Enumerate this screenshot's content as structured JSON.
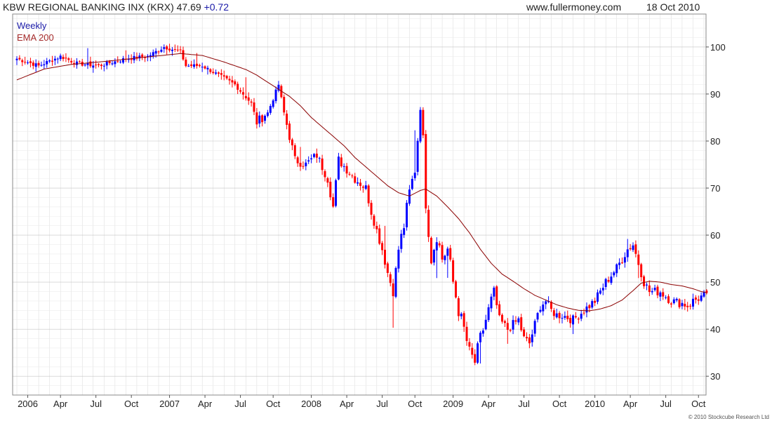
{
  "header": {
    "title": "KBW REGIONAL BANKING INX (KRX) 47.69",
    "change": "+0.72",
    "site": "www.fullermoney.com",
    "date": "18 Oct 2010"
  },
  "copyright": "© 2010 Stockcube Research Ltd",
  "colors": {
    "up": "#0000ff",
    "down": "#ff0000",
    "ema": "#8b0000",
    "grid": "#d8d8d8"
  },
  "chart_data": {
    "type": "candlestick",
    "ylim": [
      26,
      107
    ],
    "y_ticks": [
      30,
      40,
      50,
      60,
      70,
      80,
      90,
      100
    ],
    "x_ticks": [
      {
        "label": "2006",
        "i": 4
      },
      {
        "label": "Apr",
        "i": 16
      },
      {
        "label": "Jul",
        "i": 29
      },
      {
        "label": "Oct",
        "i": 42
      },
      {
        "label": "2007",
        "i": 56
      },
      {
        "label": "Apr",
        "i": 69
      },
      {
        "label": "Jul",
        "i": 82
      },
      {
        "label": "Oct",
        "i": 94
      },
      {
        "label": "2008",
        "i": 108
      },
      {
        "label": "Apr",
        "i": 121
      },
      {
        "label": "Jul",
        "i": 134
      },
      {
        "label": "Oct",
        "i": 146
      },
      {
        "label": "2009",
        "i": 160
      },
      {
        "label": "Apr",
        "i": 173
      },
      {
        "label": "Jul",
        "i": 186
      },
      {
        "label": "Oct",
        "i": 199
      },
      {
        "label": "2010",
        "i": 212
      },
      {
        "label": "Apr",
        "i": 225
      },
      {
        "label": "Jul",
        "i": 238
      },
      {
        "label": "Oct",
        "i": 250
      }
    ],
    "legend": [
      "Weekly",
      "EMA 200"
    ],
    "legend_position": "top-left",
    "anchors": [
      [
        0,
        97.5
      ],
      [
        8,
        96
      ],
      [
        16,
        98
      ],
      [
        22,
        96.5
      ],
      [
        30,
        96
      ],
      [
        40,
        97.5
      ],
      [
        48,
        98
      ],
      [
        54,
        100
      ],
      [
        60,
        99
      ],
      [
        62,
        96
      ],
      [
        68,
        96
      ],
      [
        74,
        94
      ],
      [
        80,
        92
      ],
      [
        86,
        88
      ],
      [
        88,
        84
      ],
      [
        92,
        86
      ],
      [
        96,
        92
      ],
      [
        98,
        86
      ],
      [
        102,
        76
      ],
      [
        106,
        75
      ],
      [
        110,
        77
      ],
      [
        114,
        72
      ],
      [
        116,
        66
      ],
      [
        118,
        76
      ],
      [
        124,
        72
      ],
      [
        128,
        70
      ],
      [
        130,
        65
      ],
      [
        134,
        57
      ],
      [
        136,
        52
      ],
      [
        138,
        48
      ],
      [
        140,
        57
      ],
      [
        142,
        62
      ],
      [
        144,
        69
      ],
      [
        146,
        74
      ],
      [
        148,
        87
      ],
      [
        149,
        80
      ],
      [
        150,
        67
      ],
      [
        152,
        55
      ],
      [
        154,
        60
      ],
      [
        156,
        55
      ],
      [
        158,
        57
      ],
      [
        160,
        50
      ],
      [
        162,
        44
      ],
      [
        164,
        40
      ],
      [
        166,
        35
      ],
      [
        168,
        33
      ],
      [
        170,
        38
      ],
      [
        172,
        42
      ],
      [
        175,
        48
      ],
      [
        177,
        42
      ],
      [
        180,
        40
      ],
      [
        184,
        42
      ],
      [
        186,
        38
      ],
      [
        188,
        37
      ],
      [
        190,
        41
      ],
      [
        192,
        45
      ],
      [
        194,
        46
      ],
      [
        196,
        44
      ],
      [
        198,
        43
      ],
      [
        200,
        43
      ],
      [
        204,
        42
      ],
      [
        208,
        44
      ],
      [
        212,
        46
      ],
      [
        216,
        50
      ],
      [
        220,
        53
      ],
      [
        224,
        57
      ],
      [
        226,
        58
      ],
      [
        228,
        54
      ],
      [
        230,
        50
      ],
      [
        232,
        48
      ],
      [
        236,
        48
      ],
      [
        240,
        46
      ],
      [
        244,
        45.5
      ],
      [
        246,
        45
      ],
      [
        248,
        46
      ],
      [
        252,
        47.2
      ],
      [
        253,
        47.69
      ]
    ],
    "ema_points": [
      [
        0,
        93
      ],
      [
        10,
        95.3
      ],
      [
        20,
        96.3
      ],
      [
        30,
        96.8
      ],
      [
        40,
        97.4
      ],
      [
        50,
        98
      ],
      [
        60,
        98.6
      ],
      [
        68,
        98.2
      ],
      [
        76,
        96.8
      ],
      [
        84,
        95.2
      ],
      [
        88,
        94
      ],
      [
        92,
        92.5
      ],
      [
        96,
        91
      ],
      [
        100,
        89.5
      ],
      [
        104,
        87.5
      ],
      [
        108,
        85
      ],
      [
        112,
        83
      ],
      [
        116,
        81
      ],
      [
        120,
        79
      ],
      [
        124,
        76.5
      ],
      [
        128,
        74.5
      ],
      [
        132,
        72.5
      ],
      [
        136,
        70.5
      ],
      [
        140,
        69
      ],
      [
        144,
        68.3
      ],
      [
        148,
        69.5
      ],
      [
        150,
        69.8
      ],
      [
        154,
        68.3
      ],
      [
        158,
        66
      ],
      [
        162,
        63.5
      ],
      [
        166,
        60.5
      ],
      [
        170,
        57
      ],
      [
        174,
        54
      ],
      [
        178,
        51.7
      ],
      [
        182,
        50.2
      ],
      [
        186,
        48.6
      ],
      [
        190,
        47.2
      ],
      [
        194,
        46.2
      ],
      [
        198,
        45.2
      ],
      [
        202,
        44.5
      ],
      [
        206,
        44
      ],
      [
        210,
        43.9
      ],
      [
        214,
        44.3
      ],
      [
        218,
        45
      ],
      [
        222,
        46.2
      ],
      [
        226,
        48.2
      ],
      [
        229,
        49.8
      ],
      [
        232,
        50.2
      ],
      [
        236,
        50
      ],
      [
        240,
        49.5
      ],
      [
        244,
        49.2
      ],
      [
        248,
        48.6
      ],
      [
        251,
        48
      ],
      [
        253,
        47.8
      ]
    ],
    "spikes": [
      [
        26,
        2.5
      ],
      [
        40,
        1.5
      ],
      [
        66,
        1.5
      ],
      [
        84,
        3.5
      ],
      [
        104,
        3
      ],
      [
        135,
        4
      ],
      [
        138,
        -6
      ],
      [
        146,
        8
      ],
      [
        154,
        -5
      ],
      [
        158,
        -4
      ],
      [
        170,
        -4
      ],
      [
        180,
        -2
      ],
      [
        204,
        -1
      ],
      [
        224,
        2
      ],
      [
        228,
        -2
      ]
    ],
    "last_close": 47.69,
    "ema_label": "EMA 200"
  }
}
